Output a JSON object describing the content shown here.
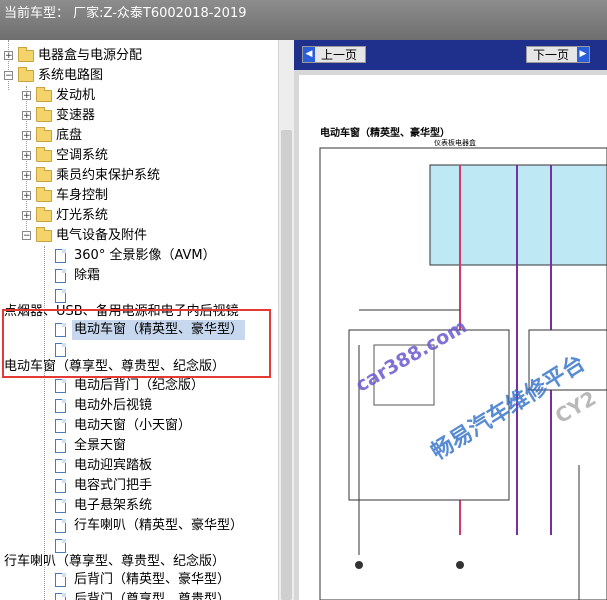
{
  "window": {
    "title": "当前车型：  厂家:Z-众泰T6002018-2019"
  },
  "tree": {
    "nodes": [
      {
        "label": "电器盒与电源分配"
      },
      {
        "label": "系统电路图"
      },
      {
        "label": "发动机"
      },
      {
        "label": "变速器"
      },
      {
        "label": "底盘"
      },
      {
        "label": "空调系统"
      },
      {
        "label": "乘员约束保护系统"
      },
      {
        "label": "车身控制"
      },
      {
        "label": "灯光系统"
      },
      {
        "label": "电气设备及附件"
      },
      {
        "label": "360° 全景影像（AVM）"
      },
      {
        "label": "除霜"
      },
      {
        "label": ""
      },
      {
        "label": "电动车窗（精英型、豪华型）"
      },
      {
        "label": ""
      },
      {
        "label": "电动后背门（纪念版）"
      },
      {
        "label": "电动外后视镜"
      },
      {
        "label": "电动天窗（小天窗）"
      },
      {
        "label": "全景天窗"
      },
      {
        "label": "电动迎宾踏板"
      },
      {
        "label": "电容式门把手"
      },
      {
        "label": "电子悬架系统"
      },
      {
        "label": "行车喇叭（精英型、豪华型）"
      },
      {
        "label": ""
      },
      {
        "label": "后背门（精英型、豪华型）"
      },
      {
        "label": "后背门（尊享型、尊贵型）"
      }
    ],
    "overflow_labels": [
      "点烟器、USB、备用电源和电子内后视镜",
      "电动车窗（尊享型、尊贵型、纪念版）",
      "行车喇叭（尊享型、尊贵型、纪念版）"
    ]
  },
  "viewer": {
    "prev_label": "上一页",
    "next_label": "下一页",
    "diagram_title": "电动车窗（精英型、豪华型）",
    "fuse_box_label": "仪表板电器盒",
    "watermarks": [
      "car388.com",
      "畅易汽车维修平台",
      "CY2"
    ]
  },
  "colors": {
    "highlight_box": "#e53935",
    "nav_bar": "#1f2f8c",
    "fuse_box_fill": "#bfe8f5"
  }
}
